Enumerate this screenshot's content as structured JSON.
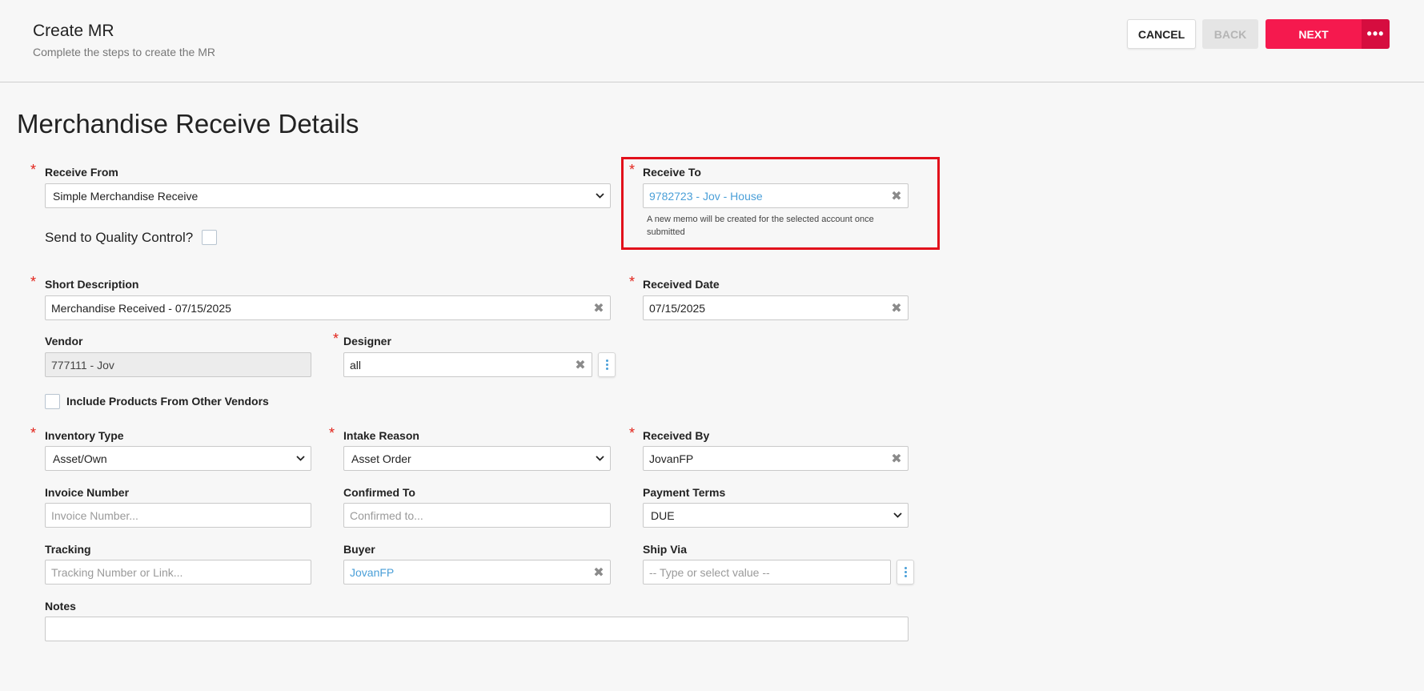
{
  "header": {
    "title": "Create MR",
    "subtitle": "Complete the steps to create the MR",
    "cancel_label": "CANCEL",
    "back_label": "BACK",
    "next_label": "NEXT",
    "more_label": "•••"
  },
  "section": {
    "title": "Merchandise Receive Details"
  },
  "form": {
    "receive_from": {
      "label": "Receive From",
      "value": "Simple Merchandise Receive"
    },
    "quality_control": {
      "label": "Send to Quality Control?"
    },
    "receive_to": {
      "label": "Receive To",
      "value": "9782723 - Jov - House",
      "note": "A new memo will be created for the selected account once submitted"
    },
    "short_description": {
      "label": "Short Description",
      "value": "Merchandise Received - 07/15/2025"
    },
    "received_date": {
      "label": "Received Date",
      "value": "07/15/2025"
    },
    "vendor": {
      "label": "Vendor",
      "value": "777111 - Jov"
    },
    "designer": {
      "label": "Designer",
      "value": "all"
    },
    "include_products": {
      "label": "Include Products From Other Vendors"
    },
    "inventory_type": {
      "label": "Inventory Type",
      "value": "Asset/Own"
    },
    "intake_reason": {
      "label": "Intake Reason",
      "value": "Asset Order"
    },
    "received_by": {
      "label": "Received By",
      "value": "JovanFP"
    },
    "invoice_number": {
      "label": "Invoice Number",
      "placeholder": "Invoice Number..."
    },
    "confirmed_to": {
      "label": "Confirmed To",
      "placeholder": "Confirmed to..."
    },
    "payment_terms": {
      "label": "Payment Terms",
      "value": "DUE"
    },
    "tracking": {
      "label": "Tracking",
      "placeholder": "Tracking Number or Link..."
    },
    "buyer": {
      "label": "Buyer",
      "value": "JovanFP"
    },
    "ship_via": {
      "label": "Ship Via",
      "placeholder": "-- Type or select value --"
    },
    "notes": {
      "label": "Notes",
      "value": ""
    }
  },
  "required_mark": "*",
  "clear_glyph": "✖",
  "colors": {
    "accent": "#f5194e",
    "accent_dark": "#d60d3f",
    "link": "#4a9fd8",
    "required": "#e2231a",
    "highlight": "#e2101b"
  }
}
